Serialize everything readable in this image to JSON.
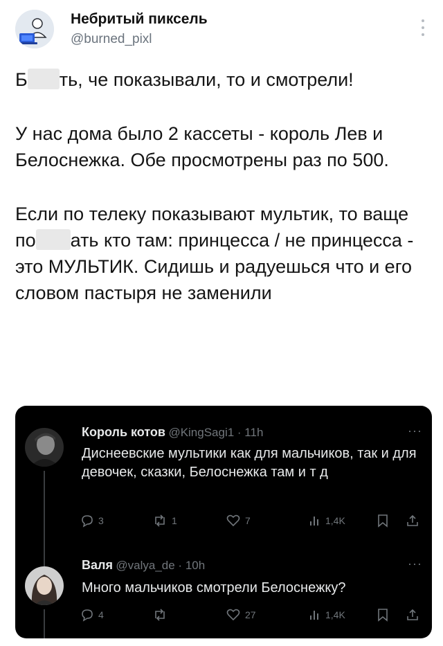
{
  "post": {
    "author_name": "Небритый пиксель",
    "author_handle": "@burned_pixl",
    "line1_start": "Б",
    "line1_end": "ть, че показывали, то и смотрели!",
    "paragraph2": "У нас дома было 2 кассеты - король Лев и Белоснежка. Обе просмотрены раз по 500.",
    "p3_start": "Если по телеку показывают мультик, то ваще по",
    "p3_end": "ать кто там: принцесса / не принцесса - это МУЛЬТИК. Сидишь и радуешься что и его словом пастыря не заменили"
  },
  "replies": [
    {
      "name": "Король котов",
      "meta": "@KingSagi1 · 11h",
      "more": "···",
      "text": "Диснеевские мультики как для мальчиков, так и для девочек, сказки, Белоснежка там и т д",
      "stats": {
        "replies": "3",
        "reposts": "1",
        "likes": "7",
        "views": "1,4K"
      }
    },
    {
      "name": "Валя",
      "meta": "@valya_de · 10h",
      "more": "···",
      "text": "Много мальчиков смотрели Белоснежку?",
      "stats": {
        "replies": "4",
        "reposts": "",
        "likes": "27",
        "views": "1,4K"
      }
    }
  ],
  "icons": {
    "more": "vertical-dots-icon",
    "reply": "comment-icon",
    "repost": "repost-icon",
    "like": "heart-icon",
    "views": "views-icon",
    "bookmark": "bookmark-icon",
    "share": "share-icon"
  },
  "colors": {
    "reply_card_bg": "#000000",
    "secondary_text": "#71767b",
    "handle_gray": "#6a737d"
  }
}
